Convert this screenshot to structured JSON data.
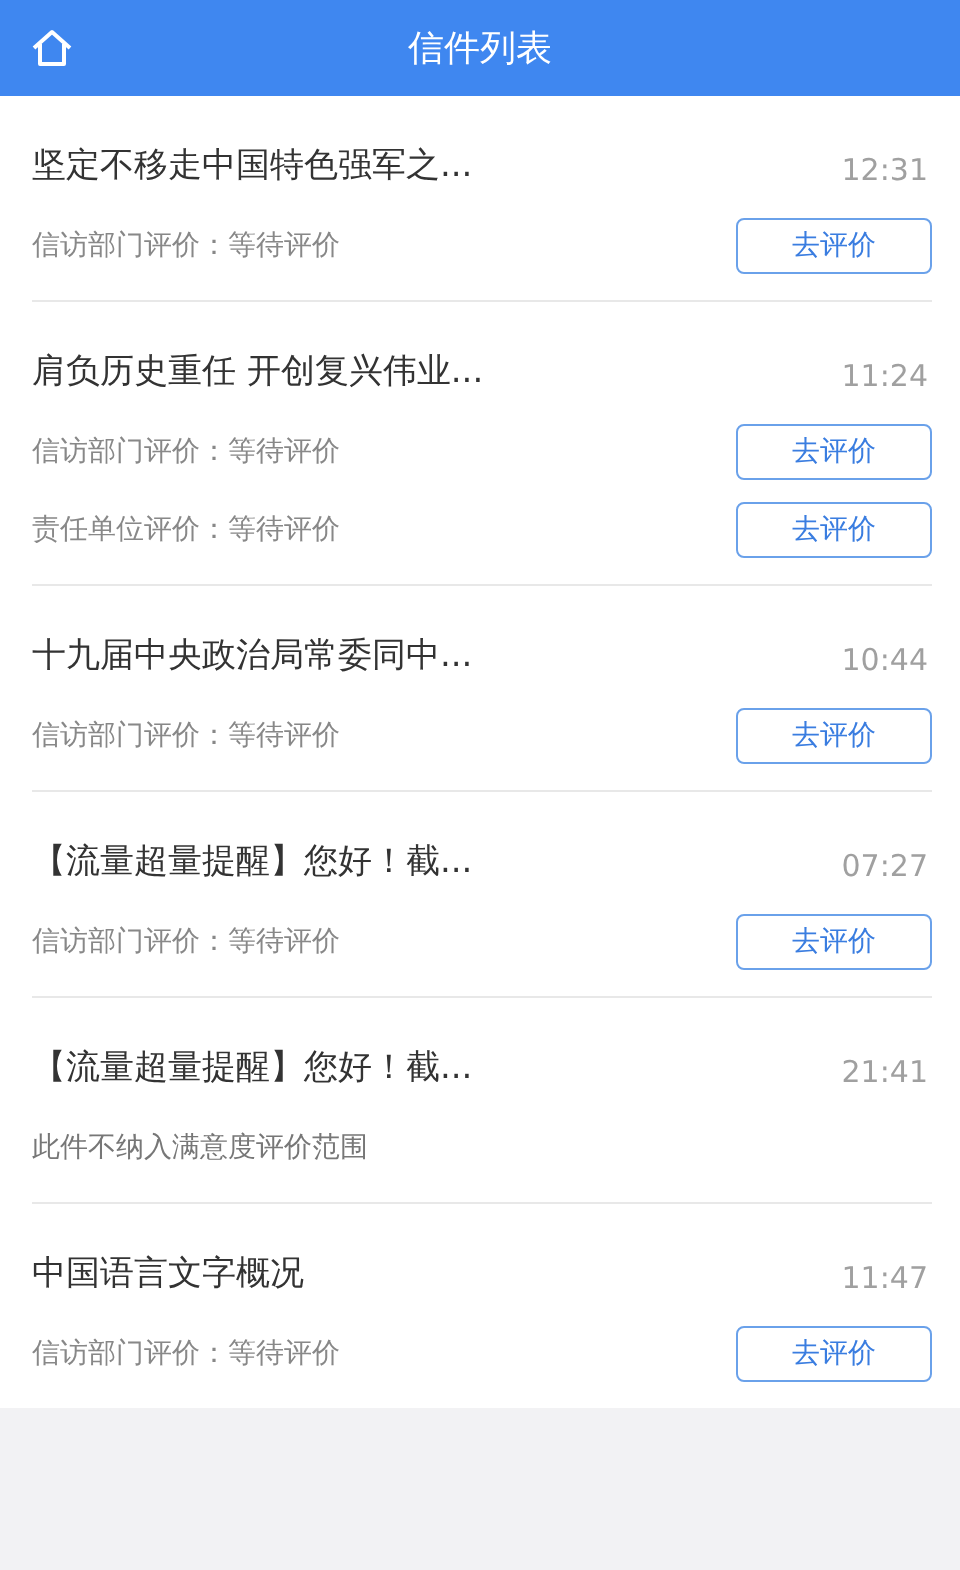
{
  "header": {
    "title": "信件列表"
  },
  "letters": [
    {
      "title": "坚定不移走中国特色强军之...",
      "time": "12:31",
      "ratings": [
        {
          "label": "信访部门评价：等待评价",
          "button": "去评价"
        }
      ]
    },
    {
      "title": "肩负历史重任 开创复兴伟业...",
      "time": "11:24",
      "ratings": [
        {
          "label": "信访部门评价：等待评价",
          "button": "去评价"
        },
        {
          "label": "责任单位评价：等待评价",
          "button": "去评价"
        }
      ]
    },
    {
      "title": "十九届中央政治局常委同中...",
      "time": "10:44",
      "ratings": [
        {
          "label": "信访部门评价：等待评价",
          "button": "去评价"
        }
      ]
    },
    {
      "title": "【流量超量提醒】您好！截...",
      "time": "07:27",
      "ratings": [
        {
          "label": "信访部门评价：等待评价",
          "button": "去评价"
        }
      ]
    },
    {
      "title": "【流量超量提醒】您好！截...",
      "time": "21:41",
      "note": "此件不纳入满意度评价范围"
    },
    {
      "title": "中国语言文字概况",
      "time": "11:47",
      "ratings": [
        {
          "label": "信访部门评价：等待评价",
          "button": "去评价"
        }
      ]
    }
  ]
}
